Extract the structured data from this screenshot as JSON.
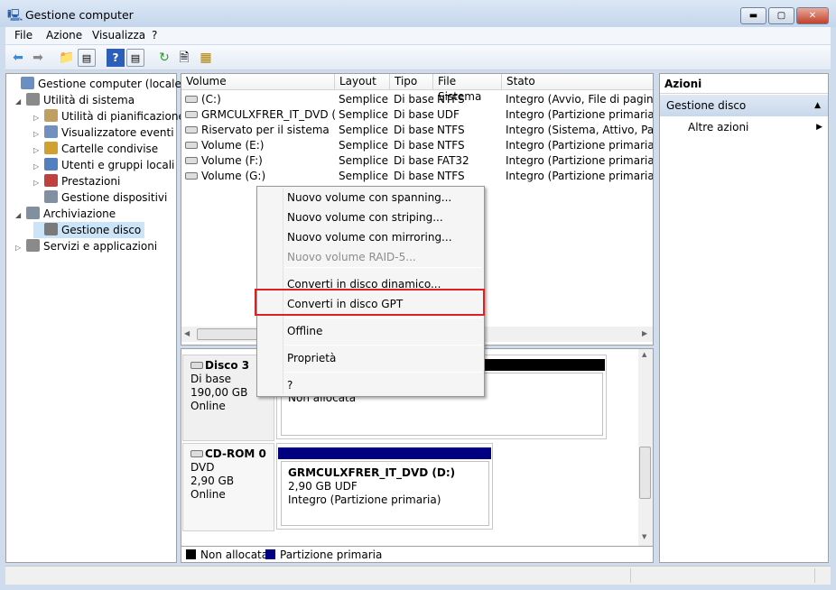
{
  "window": {
    "title": "Gestione computer",
    "minimize": "▬",
    "maximize": "▢",
    "close": "✕"
  },
  "menu": [
    "File",
    "Azione",
    "Visualizza",
    "?"
  ],
  "toolbar": [
    "back-icon",
    "forward-icon",
    "up-folder-icon",
    "show-hide-tree-icon",
    "help-icon",
    "show-hide-action-icon",
    "refresh-icon",
    "properties-icon",
    "settings-icon"
  ],
  "tree": [
    {
      "label": "Gestione computer (locale)",
      "level": 0,
      "expander": ""
    },
    {
      "label": "Utilità di sistema",
      "level": 1,
      "expander": "◢"
    },
    {
      "label": "Utilità di pianificazione",
      "level": 2,
      "expander": "▷"
    },
    {
      "label": "Visualizzatore eventi",
      "level": 2,
      "expander": "▷"
    },
    {
      "label": "Cartelle condivise",
      "level": 2,
      "expander": "▷"
    },
    {
      "label": "Utenti e gruppi locali",
      "level": 2,
      "expander": "▷"
    },
    {
      "label": "Prestazioni",
      "level": 2,
      "expander": "▷"
    },
    {
      "label": "Gestione dispositivi",
      "level": 2,
      "expander": ""
    },
    {
      "label": "Archiviazione",
      "level": 1,
      "expander": "◢"
    },
    {
      "label": "Gestione disco",
      "level": 2,
      "expander": "",
      "selected": true
    },
    {
      "label": "Servizi e applicazioni",
      "level": 1,
      "expander": "▷"
    }
  ],
  "volumes": {
    "columns": [
      "Volume",
      "Layout",
      "Tipo",
      "File Sistema",
      "Stato"
    ],
    "rows": [
      [
        "(C:)",
        "Semplice",
        "Di base",
        "NTFS",
        "Integro (Avvio, File di paging, D"
      ],
      [
        "GRMCULXFRER_IT_DVD (D:)",
        "Semplice",
        "Di base",
        "UDF",
        "Integro (Partizione primaria)"
      ],
      [
        "Riservato per il sistema",
        "Semplice",
        "Di base",
        "NTFS",
        "Integro (Sistema, Attivo, Partizi"
      ],
      [
        "Volume (E:)",
        "Semplice",
        "Di base",
        "NTFS",
        "Integro (Partizione primaria)"
      ],
      [
        "Volume (F:)",
        "Semplice",
        "Di base",
        "FAT32",
        "Integro (Partizione primaria)"
      ],
      [
        "Volume (G:)",
        "Semplice",
        "Di base",
        "NTFS",
        "Integro (Partizione primaria)"
      ]
    ]
  },
  "context_menu": [
    {
      "label": "Nuovo volume con spanning...",
      "disabled": false
    },
    {
      "label": "Nuovo volume con striping...",
      "disabled": false
    },
    {
      "label": "Nuovo volume con mirroring...",
      "disabled": false
    },
    {
      "label": "Nuovo volume RAID-5...",
      "disabled": true
    },
    {
      "label": "Converti in disco dinamico...",
      "disabled": false
    },
    {
      "label": "Converti in disco GPT",
      "disabled": false,
      "highlighted": true
    },
    {
      "label": "Offline",
      "disabled": false
    },
    {
      "label": "Proprietà",
      "disabled": false
    },
    {
      "label": "?",
      "disabled": false
    }
  ],
  "disks": [
    {
      "name": "Disco 3",
      "type": "Di base",
      "size": "190,00 GB",
      "status": "Online",
      "partition": {
        "title": "",
        "size": "190,00 GB",
        "desc": "Non allocata"
      },
      "bar_color": "#000000"
    },
    {
      "name": "CD-ROM 0",
      "type": "DVD",
      "size": "2,90 GB",
      "status": "Online",
      "partition": {
        "title": "GRMCULXFRER_IT_DVD  (D:)",
        "size": "2,90 GB UDF",
        "desc": "Integro (Partizione primaria)"
      },
      "bar_color": "#000080"
    }
  ],
  "legend": [
    {
      "label": "Non allocata",
      "color": "#000000"
    },
    {
      "label": "Partizione primaria",
      "color": "#000080"
    }
  ],
  "actions": {
    "title": "Azioni",
    "section": "Gestione disco",
    "item": "Altre azioni"
  },
  "colors": {
    "highlight_border": "#e02020",
    "selection": "#cce4f7"
  }
}
